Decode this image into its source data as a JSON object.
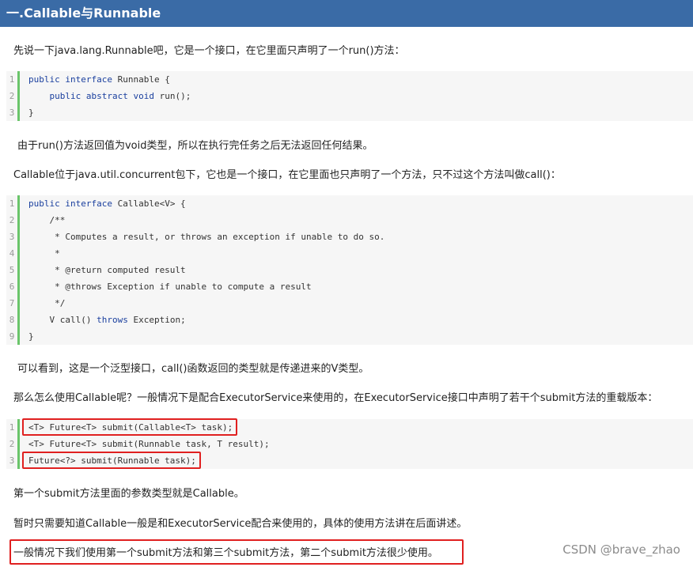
{
  "title": "一.Callable与Runnable",
  "paragraphs": {
    "p1": "先说一下java.lang.Runnable吧，它是一个接口，在它里面只声明了一个run()方法：",
    "p2": "由于run()方法返回值为void类型，所以在执行完任务之后无法返回任何结果。",
    "p3": "Callable位于java.util.concurrent包下，它也是一个接口，在它里面也只声明了一个方法，只不过这个方法叫做call()：",
    "p4": "可以看到，这是一个泛型接口，call()函数返回的类型就是传递进来的V类型。",
    "p5": "那么怎么使用Callable呢？一般情况下是配合ExecutorService来使用的，在ExecutorService接口中声明了若干个submit方法的重载版本：",
    "p6": "第一个submit方法里面的参数类型就是Callable。",
    "p7": "暂时只需要知道Callable一般是和ExecutorService配合来使用的，具体的使用方法讲在后面讲述。",
    "p8": "一般情况下我们使用第一个submit方法和第三个submit方法，第二个submit方法很少使用。"
  },
  "code1": {
    "line_numbers": [
      "1",
      "2",
      "3"
    ],
    "l1_kw": "public interface",
    "l1_rest": " Runnable {",
    "l2_indent": "    ",
    "l2_kw": "public abstract void",
    "l2_rest": " run();",
    "l3": "}"
  },
  "code2": {
    "line_numbers": [
      "1",
      "2",
      "3",
      "4",
      "5",
      "6",
      "7",
      "8",
      "9"
    ],
    "l1_kw": "public interface",
    "l1_rest": " Callable<V> {",
    "l2": "    /**",
    "l3": "     * Computes a result, or throws an exception if unable to do so.",
    "l4": "     *",
    "l5": "     * @return computed result",
    "l6": "     * @throws Exception if unable to compute a result",
    "l7": "     */",
    "l8_pre": "    V call() ",
    "l8_kw": "throws",
    "l8_rest": " Exception;",
    "l9": "}"
  },
  "code3": {
    "line_numbers": [
      "1",
      "2",
      "3"
    ],
    "l1": "<T> Future<T> submit(Callable<T> task);",
    "l2": "<T> Future<T> submit(Runnable task, T result);",
    "l3": "Future<?> submit(Runnable task);"
  },
  "watermark": "CSDN @brave_zhao",
  "colors": {
    "title_bg": "#3a6ba6",
    "gutter": "#6ac56a",
    "highlight_border": "#e02020",
    "keyword": "#1a3f9e"
  }
}
